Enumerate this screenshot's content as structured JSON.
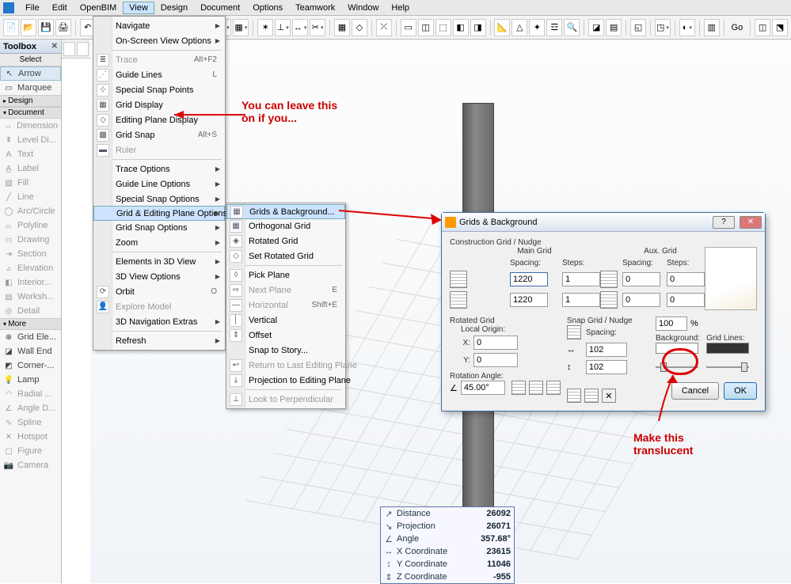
{
  "menubar": {
    "items": [
      "File",
      "Edit",
      "OpenBIM",
      "View",
      "Design",
      "Document",
      "Options",
      "Teamwork",
      "Window",
      "Help"
    ],
    "open_index": 3
  },
  "toolbox": {
    "title": "Toolbox",
    "select_hdr": "Select",
    "arrow": "Arrow",
    "marquee": "Marquee",
    "sections": {
      "design": "Design",
      "document": "Document",
      "more": "More"
    },
    "doc_items": [
      "Dimension",
      "Level Di...",
      "Text",
      "Label",
      "Fill",
      "Line",
      "Arc/Circle",
      "Polyline",
      "Drawing",
      "Section",
      "Elevation",
      "Interior...",
      "Worksh...",
      "Detail"
    ],
    "more_items": [
      "Grid Ele...",
      "Wall End",
      "Corner-...",
      "Lamp",
      "Radial ...",
      "Angle D...",
      "Spline",
      "Hotspot",
      "Figure",
      "Camera"
    ]
  },
  "view_menu": {
    "navigate": "Navigate",
    "onscreen": "On-Screen View Options",
    "trace": "Trace",
    "trace_acc": "Alt+F2",
    "guidelines": "Guide Lines",
    "guidelines_acc": "L",
    "snap_pts": "Special Snap Points",
    "grid_display": "Grid Display",
    "editing_plane": "Editing Plane Display",
    "grid_snap": "Grid Snap",
    "grid_snap_acc": "Alt+S",
    "ruler": "Ruler",
    "trace_opts": "Trace Options",
    "guideline_opts": "Guide Line Options",
    "snap_opts": "Special Snap Options",
    "grid_edit_opts": "Grid & Editing Plane Options",
    "grid_snap_opts": "Grid Snap Options",
    "zoom": "Zoom",
    "elem3d": "Elements in 3D View",
    "view3d_opts": "3D View Options",
    "orbit": "Orbit",
    "orbit_acc": "O",
    "explore": "Explore Model",
    "nav_extras": "3D Navigation Extras",
    "refresh": "Refresh"
  },
  "submenu": {
    "grids_bg": "Grids & Background...",
    "ortho": "Orthogonal Grid",
    "rotated": "Rotated Grid",
    "set_rotated": "Set Rotated Grid",
    "pick_plane": "Pick Plane",
    "next_plane": "Next Plane",
    "next_acc": "E",
    "horizontal": "Horizontal",
    "horiz_acc": "Shift+E",
    "vertical": "Vertical",
    "offset": "Offset",
    "snap_story": "Snap to Story...",
    "return_last": "Return to Last Editing Plane",
    "project_plane": "Projection to Editing Plane",
    "look_perp": "Look to Perpendicular"
  },
  "dialog": {
    "title": "Grids & Background",
    "construct_lbl": "Construction Grid / Nudge",
    "main_grid": "Main Grid",
    "aux_grid": "Aux. Grid",
    "spacing": "Spacing:",
    "steps": "Steps:",
    "main_sp1": "1220",
    "main_st1": "1",
    "main_sp2": "1220",
    "main_st2": "1",
    "aux_sp1": "0",
    "aux_st1": "0",
    "aux_sp2": "0",
    "aux_st2": "0",
    "rotated_lbl": "Rotated Grid",
    "local_origin": "Local Origin:",
    "x_lbl": "X:",
    "y_lbl": "Y:",
    "x_val": "0",
    "y_val": "0",
    "rot_angle_lbl": "Rotation Angle:",
    "rot_angle": "45.00°",
    "snap_lbl": "Snap Grid / Nudge",
    "snap_sp": "Spacing:",
    "snap1": "102",
    "snap2": "102",
    "zoom_pct": "100",
    "pct": "%",
    "bg_lbl": "Background:",
    "gl_lbl": "Grid Lines:",
    "cancel": "Cancel",
    "ok": "OK"
  },
  "tracker": {
    "distance_l": "Distance",
    "distance": "26092",
    "projection_l": "Projection",
    "projection": "26071",
    "angle_l": "Angle",
    "angle": "357.68°",
    "xcoord_l": "X Coordinate",
    "xcoord": "23615",
    "ycoord_l": "Y Coordinate",
    "ycoord": "11046",
    "zcoord_l": "Z Coordinate",
    "zcoord": "-955"
  },
  "annotations": {
    "a1": "You can leave this\non if you...",
    "a2": "Make this\ntranslucent"
  },
  "goto": "Go"
}
